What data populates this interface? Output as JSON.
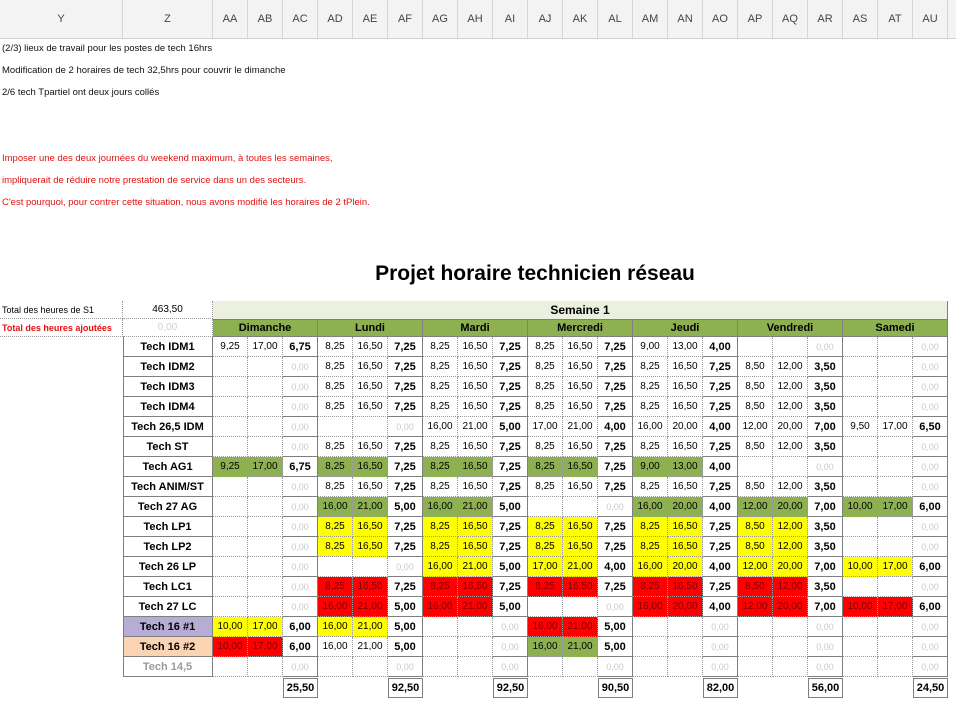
{
  "column_headers": [
    "Y",
    "Z",
    "AA",
    "AB",
    "AC",
    "AD",
    "AE",
    "AF",
    "AG",
    "AH",
    "AI",
    "AJ",
    "AK",
    "AL",
    "AM",
    "AN",
    "AO",
    "AP",
    "AQ",
    "AR",
    "AS",
    "AT",
    "AU"
  ],
  "notes": [
    {
      "text": "(2/3) lieux de travail pour les postes de tech 16hrs",
      "style": "black"
    },
    {
      "text": "Modification de 2 horaires de tech 32,5hrs pour couvrir le dimanche",
      "style": "black"
    },
    {
      "text": "2/6 tech Tpartiel ont deux jours collés",
      "style": "black"
    },
    {
      "text": "Imposer une des deux journées du weekend maximum, à toutes les semaines,",
      "style": "red"
    },
    {
      "text": "impliquerait de réduire notre prestation de service dans un des secteurs.",
      "style": "red"
    },
    {
      "text": "C'est pourquoi, pour contrer cette situation, nous avons modifié les horaires de 2 tPlein.",
      "style": "red"
    }
  ],
  "title": "Projet horaire technicien réseau",
  "summary": {
    "total_label": "Total des heures de S1",
    "total_value": "463,50",
    "added_label": "Total des heures ajoutées",
    "added_value": "0,00"
  },
  "week_label": "Semaine 1",
  "days": [
    "Dimanche",
    "Lundi",
    "Mardi",
    "Mercredi",
    "Jeudi",
    "Vendredi",
    "Samedi"
  ],
  "colors": {
    "green": "#8db150",
    "yellow": "#ffff00",
    "red": "#ff0000",
    "purple": "#b7acd6",
    "peach": "#fbd4b4",
    "semaine": "#ebf1de"
  },
  "rows": [
    {
      "name": "Tech IDM1",
      "days": [
        [
          "9,25",
          "17,00",
          "6,75",
          ""
        ],
        [
          "8,25",
          "16,50",
          "7,25",
          ""
        ],
        [
          "8,25",
          "16,50",
          "7,25",
          ""
        ],
        [
          "8,25",
          "16,50",
          "7,25",
          ""
        ],
        [
          "9,00",
          "13,00",
          "4,00",
          ""
        ],
        [
          "",
          "",
          "0,00",
          ""
        ],
        [
          "",
          "",
          "0,00",
          ""
        ]
      ]
    },
    {
      "name": "Tech IDM2",
      "days": [
        [
          "",
          "",
          "0,00",
          ""
        ],
        [
          "8,25",
          "16,50",
          "7,25",
          ""
        ],
        [
          "8,25",
          "16,50",
          "7,25",
          ""
        ],
        [
          "8,25",
          "16,50",
          "7,25",
          ""
        ],
        [
          "8,25",
          "16,50",
          "7,25",
          ""
        ],
        [
          "8,50",
          "12,00",
          "3,50",
          ""
        ],
        [
          "",
          "",
          "0,00",
          ""
        ]
      ]
    },
    {
      "name": "Tech IDM3",
      "days": [
        [
          "",
          "",
          "0,00",
          ""
        ],
        [
          "8,25",
          "16,50",
          "7,25",
          ""
        ],
        [
          "8,25",
          "16,50",
          "7,25",
          ""
        ],
        [
          "8,25",
          "16,50",
          "7,25",
          ""
        ],
        [
          "8,25",
          "16,50",
          "7,25",
          ""
        ],
        [
          "8,50",
          "12,00",
          "3,50",
          ""
        ],
        [
          "",
          "",
          "0,00",
          ""
        ]
      ]
    },
    {
      "name": "Tech IDM4",
      "days": [
        [
          "",
          "",
          "0,00",
          ""
        ],
        [
          "8,25",
          "16,50",
          "7,25",
          ""
        ],
        [
          "8,25",
          "16,50",
          "7,25",
          ""
        ],
        [
          "8,25",
          "16,50",
          "7,25",
          ""
        ],
        [
          "8,25",
          "16,50",
          "7,25",
          ""
        ],
        [
          "8,50",
          "12,00",
          "3,50",
          ""
        ],
        [
          "",
          "",
          "0,00",
          ""
        ]
      ]
    },
    {
      "name": "Tech 26,5 IDM",
      "days": [
        [
          "",
          "",
          "0,00",
          ""
        ],
        [
          "",
          "",
          "0,00",
          ""
        ],
        [
          "16,00",
          "21,00",
          "5,00",
          ""
        ],
        [
          "17,00",
          "21,00",
          "4,00",
          ""
        ],
        [
          "16,00",
          "20,00",
          "4,00",
          ""
        ],
        [
          "12,00",
          "20,00",
          "7,00",
          ""
        ],
        [
          "9,50",
          "17,00",
          "6,50",
          ""
        ]
      ]
    },
    {
      "name": "Tech ST",
      "days": [
        [
          "",
          "",
          "0,00",
          ""
        ],
        [
          "8,25",
          "16,50",
          "7,25",
          ""
        ],
        [
          "8,25",
          "16,50",
          "7,25",
          ""
        ],
        [
          "8,25",
          "16,50",
          "7,25",
          ""
        ],
        [
          "8,25",
          "16,50",
          "7,25",
          ""
        ],
        [
          "8,50",
          "12,00",
          "3,50",
          ""
        ],
        [
          "",
          "",
          "0,00",
          ""
        ]
      ]
    },
    {
      "name": "Tech AG1",
      "days": [
        [
          "9,25",
          "17,00",
          "6,75",
          "green"
        ],
        [
          "8,25",
          "16,50",
          "7,25",
          "green"
        ],
        [
          "8,25",
          "16,50",
          "7,25",
          "green"
        ],
        [
          "8,25",
          "16,50",
          "7,25",
          "green"
        ],
        [
          "9,00",
          "13,00",
          "4,00",
          "green"
        ],
        [
          "",
          "",
          "0,00",
          ""
        ],
        [
          "",
          "",
          "0,00",
          ""
        ]
      ]
    },
    {
      "name": "Tech ANIM/ST",
      "days": [
        [
          "",
          "",
          "0,00",
          ""
        ],
        [
          "8,25",
          "16,50",
          "7,25",
          ""
        ],
        [
          "8,25",
          "16,50",
          "7,25",
          ""
        ],
        [
          "8,25",
          "16,50",
          "7,25",
          ""
        ],
        [
          "8,25",
          "16,50",
          "7,25",
          ""
        ],
        [
          "8,50",
          "12,00",
          "3,50",
          ""
        ],
        [
          "",
          "",
          "0,00",
          ""
        ]
      ]
    },
    {
      "name": "Tech 27 AG",
      "days": [
        [
          "",
          "",
          "0,00",
          ""
        ],
        [
          "16,00",
          "21,00",
          "5,00",
          "green"
        ],
        [
          "16,00",
          "21,00",
          "5,00",
          "green"
        ],
        [
          "",
          "",
          "0,00",
          ""
        ],
        [
          "16,00",
          "20,00",
          "4,00",
          "green"
        ],
        [
          "12,00",
          "20,00",
          "7,00",
          "green"
        ],
        [
          "10,00",
          "17,00",
          "6,00",
          "green"
        ]
      ]
    },
    {
      "name": "Tech LP1",
      "days": [
        [
          "",
          "",
          "0,00",
          ""
        ],
        [
          "8,25",
          "16,50",
          "7,25",
          "yellow"
        ],
        [
          "8,25",
          "16,50",
          "7,25",
          "yellow"
        ],
        [
          "8,25",
          "16,50",
          "7,25",
          "yellow"
        ],
        [
          "8,25",
          "16,50",
          "7,25",
          "yellow"
        ],
        [
          "8,50",
          "12,00",
          "3,50",
          "yellow"
        ],
        [
          "",
          "",
          "0,00",
          ""
        ]
      ]
    },
    {
      "name": "Tech LP2",
      "days": [
        [
          "",
          "",
          "0,00",
          ""
        ],
        [
          "8,25",
          "16,50",
          "7,25",
          "yellow"
        ],
        [
          "8,25",
          "16,50",
          "7,25",
          "yellow"
        ],
        [
          "8,25",
          "16,50",
          "7,25",
          "yellow"
        ],
        [
          "8,25",
          "16,50",
          "7,25",
          "yellow"
        ],
        [
          "8,50",
          "12,00",
          "3,50",
          "yellow"
        ],
        [
          "",
          "",
          "0,00",
          ""
        ]
      ]
    },
    {
      "name": "Tech 26 LP",
      "days": [
        [
          "",
          "",
          "0,00",
          ""
        ],
        [
          "",
          "",
          "0,00",
          ""
        ],
        [
          "16,00",
          "21,00",
          "5,00",
          "yellow"
        ],
        [
          "17,00",
          "21,00",
          "4,00",
          "yellow"
        ],
        [
          "16,00",
          "20,00",
          "4,00",
          "yellow"
        ],
        [
          "12,00",
          "20,00",
          "7,00",
          "yellow"
        ],
        [
          "10,00",
          "17,00",
          "6,00",
          "yellow"
        ]
      ]
    },
    {
      "name": "Tech LC1",
      "days": [
        [
          "",
          "",
          "0,00",
          ""
        ],
        [
          "8,25",
          "16,50",
          "7,25",
          "red"
        ],
        [
          "8,25",
          "16,50",
          "7,25",
          "red"
        ],
        [
          "8,25",
          "16,50",
          "7,25",
          "red"
        ],
        [
          "8,25",
          "16,50",
          "7,25",
          "red"
        ],
        [
          "8,50",
          "12,00",
          "3,50",
          "red"
        ],
        [
          "",
          "",
          "0,00",
          ""
        ]
      ]
    },
    {
      "name": "Tech 27 LC",
      "days": [
        [
          "",
          "",
          "0,00",
          ""
        ],
        [
          "16,00",
          "21,00",
          "5,00",
          "red"
        ],
        [
          "16,00",
          "21,00",
          "5,00",
          "red"
        ],
        [
          "",
          "",
          "0,00",
          ""
        ],
        [
          "16,00",
          "20,00",
          "4,00",
          "red"
        ],
        [
          "12,00",
          "20,00",
          "7,00",
          "red"
        ],
        [
          "10,00",
          "17,00",
          "6,00",
          "red"
        ]
      ]
    },
    {
      "name": "Tech 16 #1",
      "name_bg": "purple",
      "days": [
        [
          "10,00",
          "17,00",
          "6,00",
          "yellow"
        ],
        [
          "16,00",
          "21,00",
          "5,00",
          "yellow"
        ],
        [
          "",
          "",
          "0,00",
          ""
        ],
        [
          "16,00",
          "21,00",
          "5,00",
          "red"
        ],
        [
          "",
          "",
          "0,00",
          ""
        ],
        [
          "",
          "",
          "0,00",
          ""
        ],
        [
          "",
          "",
          "0,00",
          ""
        ]
      ]
    },
    {
      "name": "Tech 16 #2",
      "name_bg": "peach",
      "days": [
        [
          "10,00",
          "17,00",
          "6,00",
          "red"
        ],
        [
          "16,00",
          "21,00",
          "5,00",
          ""
        ],
        [
          "",
          "",
          "0,00",
          ""
        ],
        [
          "16,00",
          "21,00",
          "5,00",
          "green"
        ],
        [
          "",
          "",
          "0,00",
          ""
        ],
        [
          "",
          "",
          "0,00",
          ""
        ],
        [
          "",
          "",
          "0,00",
          ""
        ]
      ]
    },
    {
      "name": "Tech 14,5",
      "name_style": "grey",
      "days": [
        [
          "",
          "",
          "0,00",
          ""
        ],
        [
          "",
          "",
          "0,00",
          ""
        ],
        [
          "",
          "",
          "0,00",
          ""
        ],
        [
          "",
          "",
          "0,00",
          ""
        ],
        [
          "",
          "",
          "0,00",
          ""
        ],
        [
          "",
          "",
          "0,00",
          ""
        ],
        [
          "",
          "",
          "0,00",
          ""
        ]
      ]
    }
  ],
  "day_totals": [
    "25,50",
    "92,50",
    "92,50",
    "90,50",
    "82,00",
    "56,00",
    "24,50"
  ]
}
